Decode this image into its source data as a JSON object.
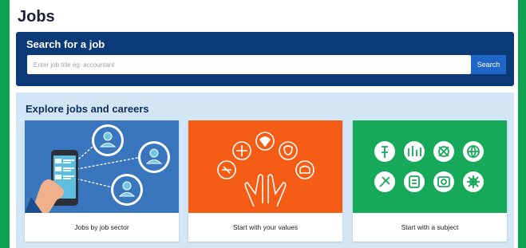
{
  "page": {
    "title": "Jobs"
  },
  "search": {
    "heading": "Search for a job",
    "placeholder": "Enter job title eg: accountant",
    "button_label": "Search"
  },
  "explore": {
    "heading": "Explore jobs and careers",
    "cards": [
      {
        "label": "Jobs by job sector",
        "image_color": "#3a76be",
        "icon": "phone-people-network-icon"
      },
      {
        "label": "Start with your values",
        "image_color": "#f55c15",
        "icon": "hands-values-icon"
      },
      {
        "label": "Start with a subject",
        "image_color": "#16a95a",
        "icon": "subject-icons-grid"
      }
    ]
  },
  "colors": {
    "background": "#0ea14f",
    "search_panel": "#0b3a78",
    "search_button": "#1f66c6",
    "explore_panel": "#d3e6f6"
  }
}
